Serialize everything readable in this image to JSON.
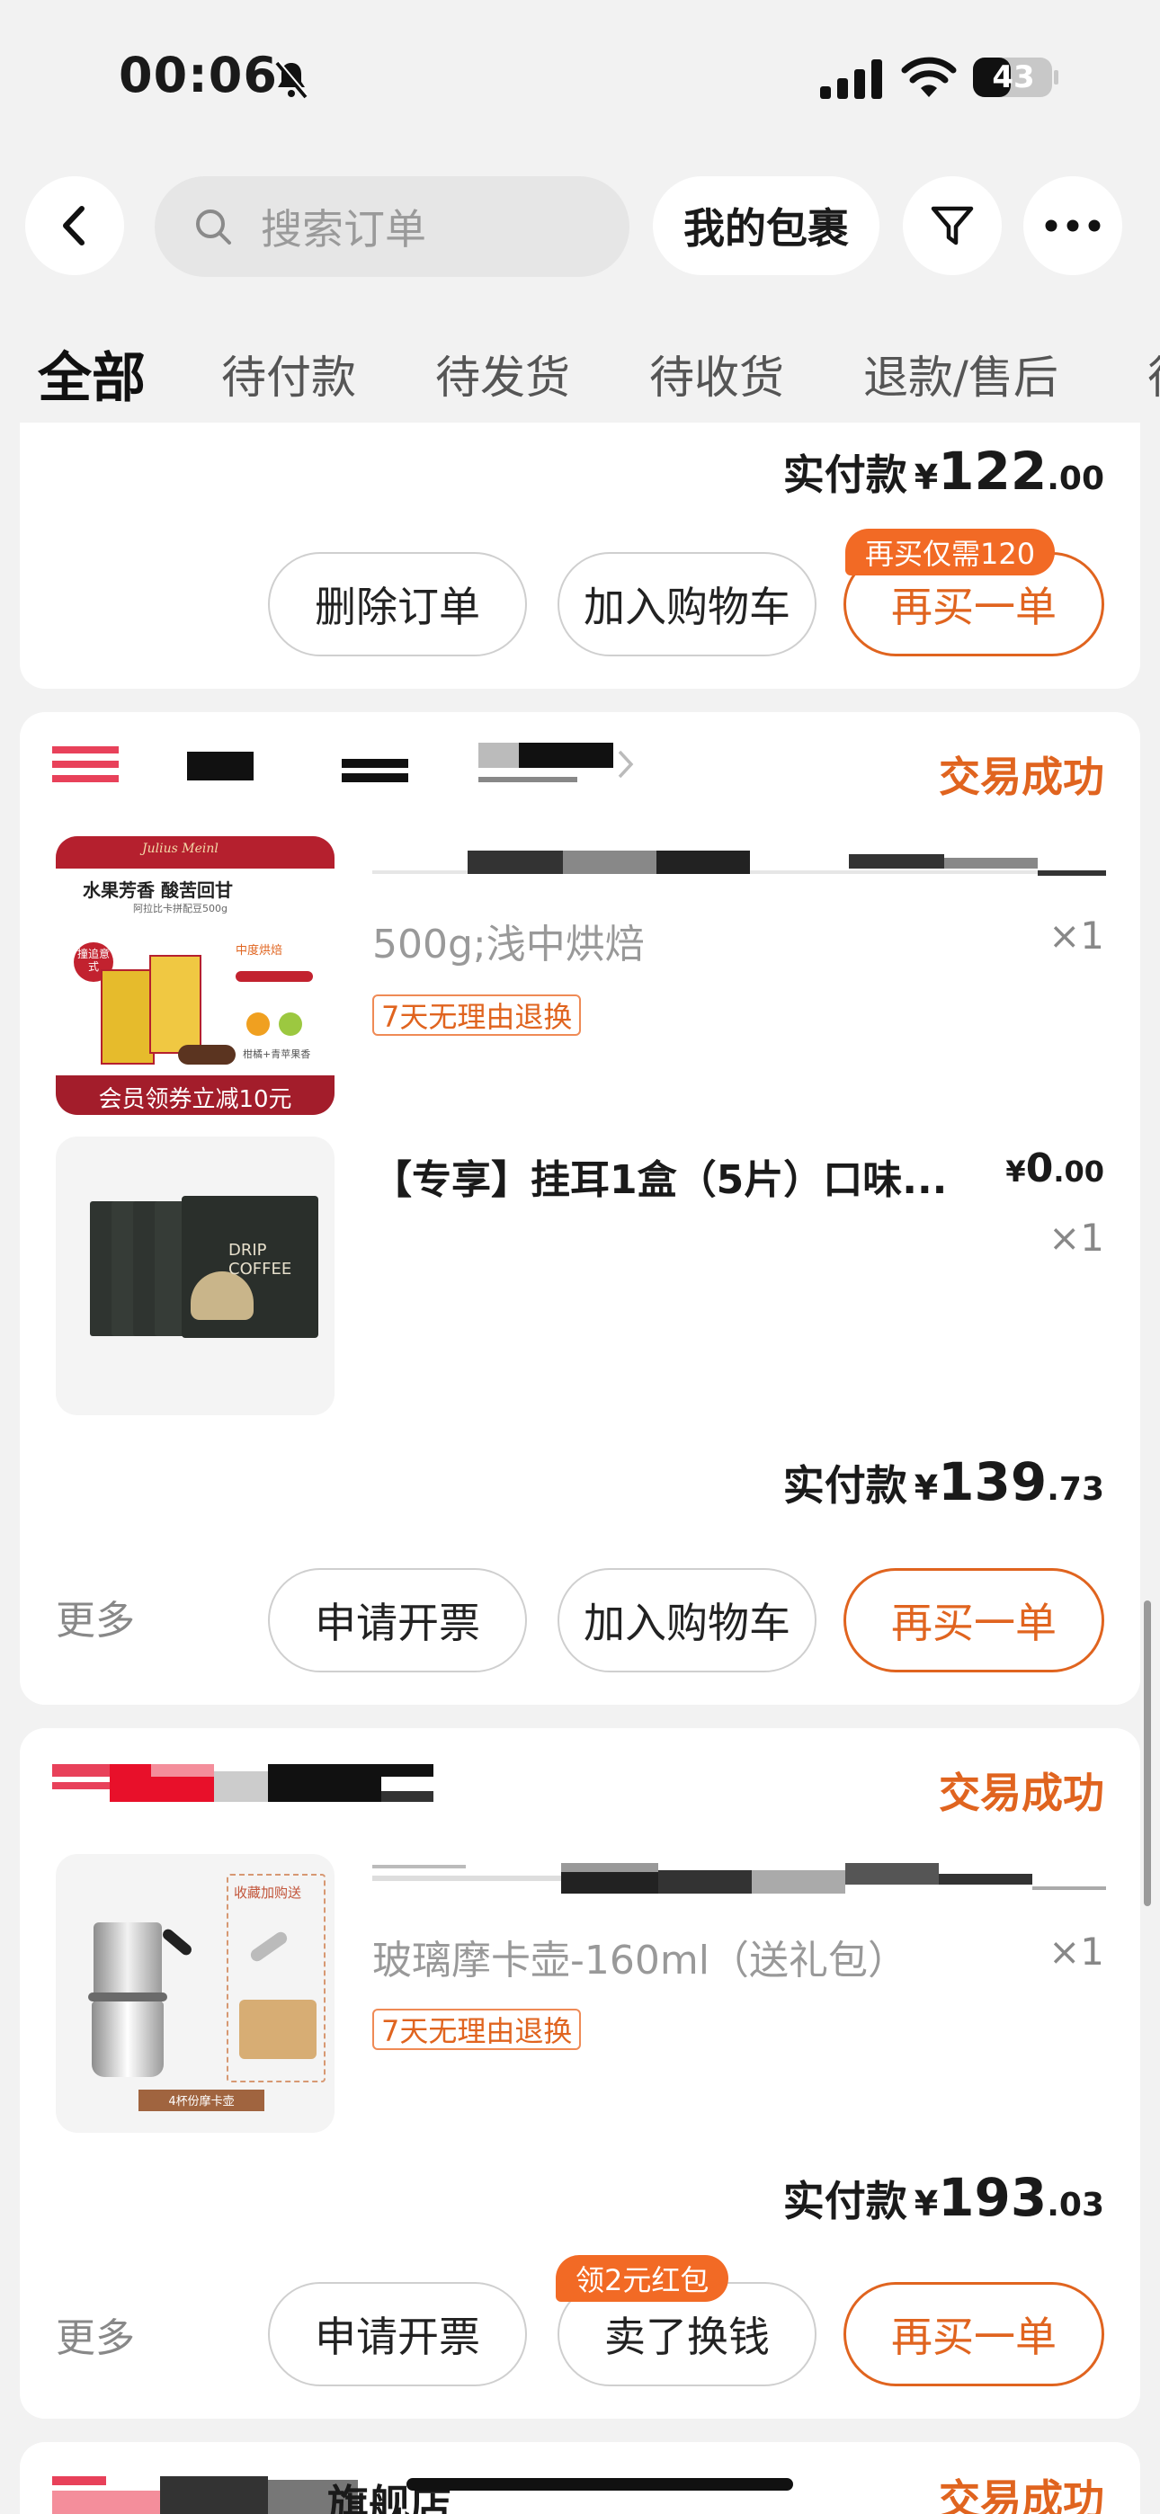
{
  "status_bar": {
    "time": "00:06",
    "battery": "43"
  },
  "nav": {
    "search_placeholder": "搜索订单",
    "parcel_label": "我的包裹"
  },
  "tabs": [
    {
      "label": "全部"
    },
    {
      "label": "待付款"
    },
    {
      "label": "待发货"
    },
    {
      "label": "待收货"
    },
    {
      "label": "退款/售后"
    },
    {
      "label": "待"
    }
  ],
  "orders": [
    {
      "pay_label": "实付款",
      "currency": "¥",
      "pay_int": "122",
      "pay_dec": ".00",
      "buttons": [
        "删除订单",
        "加入购物车",
        "再买一单"
      ],
      "promo": "再买仅需120"
    },
    {
      "status": "交易成功",
      "items": [
        {
          "img_tagline": "水果芳香 酸苦回甘",
          "img_sub": "阿拉比卡拼配豆500g",
          "img_coupon": "会员领券立减10元",
          "img_brand": "Julius Meinl",
          "img_badge": "撞追意式",
          "img_roast": "中度烘焙",
          "img_flavor": "柑橘+青苹果香",
          "spec": "500g;浅中烘焙",
          "qty": "×1",
          "return_policy": "7天无理由退换"
        },
        {
          "title": "【专享】挂耳1盒（5片）口味...",
          "currency": "¥",
          "price_int": "0",
          "price_dec": ".00",
          "qty": "×1",
          "img_text": "DRIP COFFEE"
        }
      ],
      "pay_label": "实付款",
      "currency": "¥",
      "pay_int": "139",
      "pay_dec": ".73",
      "more": "更多",
      "buttons": [
        "申请开票",
        "加入购物车",
        "再买一单"
      ]
    },
    {
      "status": "交易成功",
      "items": [
        {
          "spec": "玻璃摩卡壶-160ml（送礼包）",
          "qty": "×1",
          "return_policy": "7天无理由退换",
          "img_gift": "收藏加购送",
          "img_caption": "4杯份摩卡壶"
        }
      ],
      "pay_label": "实付款",
      "currency": "¥",
      "pay_int": "193",
      "pay_dec": ".03",
      "more": "更多",
      "buttons": [
        "申请开票",
        "卖了换钱",
        "再买一单"
      ],
      "promo": "领2元红包"
    },
    {
      "store_suffix": "旗舰店",
      "status": "交易成功"
    }
  ]
}
